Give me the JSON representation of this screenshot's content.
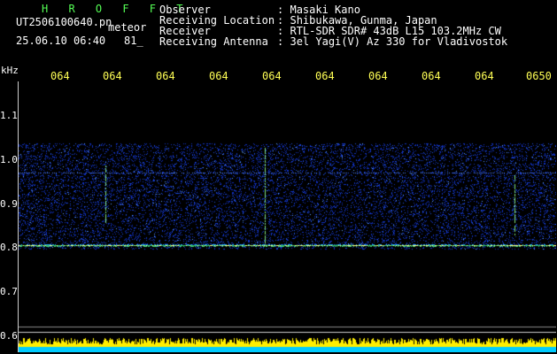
{
  "header": {
    "brand": "H R O F F T",
    "filename": "UT2506100640.pn",
    "suffix": "meteor",
    "datetime": "25.06.10 06:40",
    "count": "81_",
    "fields": [
      {
        "label": "Observer",
        "value": "Masaki Kano"
      },
      {
        "label": "Receiving Location",
        "value": "Shibukawa, Gunma, Japan"
      },
      {
        "label": "Receiver",
        "value": "RTL-SDR SDR# 43dB L15 103.2MHz CW"
      },
      {
        "label": "Receiving Antenna",
        "value": "3el Yagi(V) Az 330 for Vladivostok"
      }
    ],
    "separator": ":"
  },
  "axes": {
    "y_unit": "kHz",
    "y_ticks": [
      "1.1",
      "1.0",
      "0.9",
      "0.8",
      "0.7",
      "0.6"
    ],
    "x_ticks": [
      "064",
      "064",
      "064",
      "064",
      "064",
      "064",
      "064",
      "064",
      "064",
      "0650"
    ]
  },
  "colors": {
    "background": "#000000",
    "brand": "#55ff55",
    "x_ticks": "#ffff55",
    "noise_band": "#1030c0",
    "signal_line": "#ffff80",
    "bottom_bar": "#ffee00",
    "bottom_base": "#00ccff"
  }
}
